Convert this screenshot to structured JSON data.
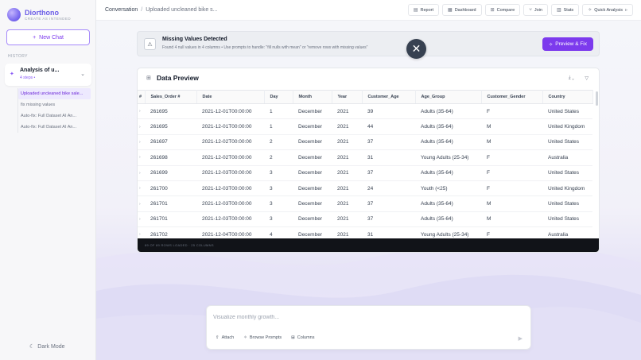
{
  "app": {
    "name": "Diorthono",
    "tagline": "CREATE AS INTENDED"
  },
  "sidebar": {
    "new_chat_label": "New Chat",
    "history_label": "HISTORY",
    "conversation": {
      "title": "Analysis of u...",
      "steps": "4 steps •"
    },
    "sub_items": [
      {
        "label": "Uploaded uncleaned bike sale...",
        "active": true
      },
      {
        "label": "fix missing values",
        "active": false
      },
      {
        "label": "Auto-fix: Full Dataset AI An...",
        "active": false
      },
      {
        "label": "Auto-fix: Full Dataset AI An...",
        "active": false
      }
    ],
    "dark_mode_label": "Dark Mode"
  },
  "header": {
    "breadcrumb_root": "Conversation",
    "breadcrumb_current": "Uploaded uncleaned bike s...",
    "buttons": {
      "report": "Report",
      "dashboard": "Dashboard",
      "compare": "Compare",
      "join": "Join",
      "stats": "Stats",
      "quick_analysis": "Quick Analysis"
    }
  },
  "alert": {
    "title": "Missing Values Detected",
    "text": "Found 4 null values in 4 columns  • Use prompts to handle: \"fill nulls with mean\" or \"remove rows with missing values\"",
    "button_label": "Preview & Fix"
  },
  "preview": {
    "title": "Data Preview",
    "columns": [
      "#",
      "Sales_Order #",
      "Date",
      "Day",
      "Month",
      "Year",
      "Customer_Age",
      "Age_Group",
      "Customer_Gender",
      "Country"
    ],
    "rows": [
      [
        "›",
        "261695",
        "2021-12-01T00:00:00",
        "1",
        "December",
        "2021",
        "39",
        "Adults (35-64)",
        "F",
        "United States"
      ],
      [
        "›",
        "261695",
        "2021-12-01T00:00:00",
        "1",
        "December",
        "2021",
        "44",
        "Adults (35-64)",
        "M",
        "United Kingdom"
      ],
      [
        "›",
        "261697",
        "2021-12-02T00:00:00",
        "2",
        "December",
        "2021",
        "37",
        "Adults (35-64)",
        "M",
        "United States"
      ],
      [
        "›",
        "261698",
        "2021-12-02T00:00:00",
        "2",
        "December",
        "2021",
        "31",
        "Young Adults (25-34)",
        "F",
        "Australia"
      ],
      [
        "›",
        "261699",
        "2021-12-03T00:00:00",
        "3",
        "December",
        "2021",
        "37",
        "Adults (35-64)",
        "F",
        "United States"
      ],
      [
        "›",
        "261700",
        "2021-12-03T00:00:00",
        "3",
        "December",
        "2021",
        "24",
        "Youth (<25)",
        "F",
        "United Kingdom"
      ],
      [
        "›",
        "261701",
        "2021-12-03T00:00:00",
        "3",
        "December",
        "2021",
        "37",
        "Adults (35-64)",
        "M",
        "United States"
      ],
      [
        "›",
        "261701",
        "2021-12-03T00:00:00",
        "3",
        "December",
        "2021",
        "37",
        "Adults (35-64)",
        "M",
        "United States"
      ],
      [
        "›",
        "261702",
        "2021-12-04T00:00:00",
        "4",
        "December",
        "2021",
        "31",
        "Young Adults (25-34)",
        "F",
        "Australia"
      ]
    ],
    "footer": "89 OF 89 ROWS LOADED  ·  25 COLUMNS"
  },
  "composer": {
    "placeholder": "Visualize monthly growth...",
    "attach": "Attach",
    "browse_prompts": "Browse Prompts",
    "columns": "Columns"
  },
  "colors": {
    "accent": "#7c3aed",
    "footer_bg": "#111318"
  }
}
